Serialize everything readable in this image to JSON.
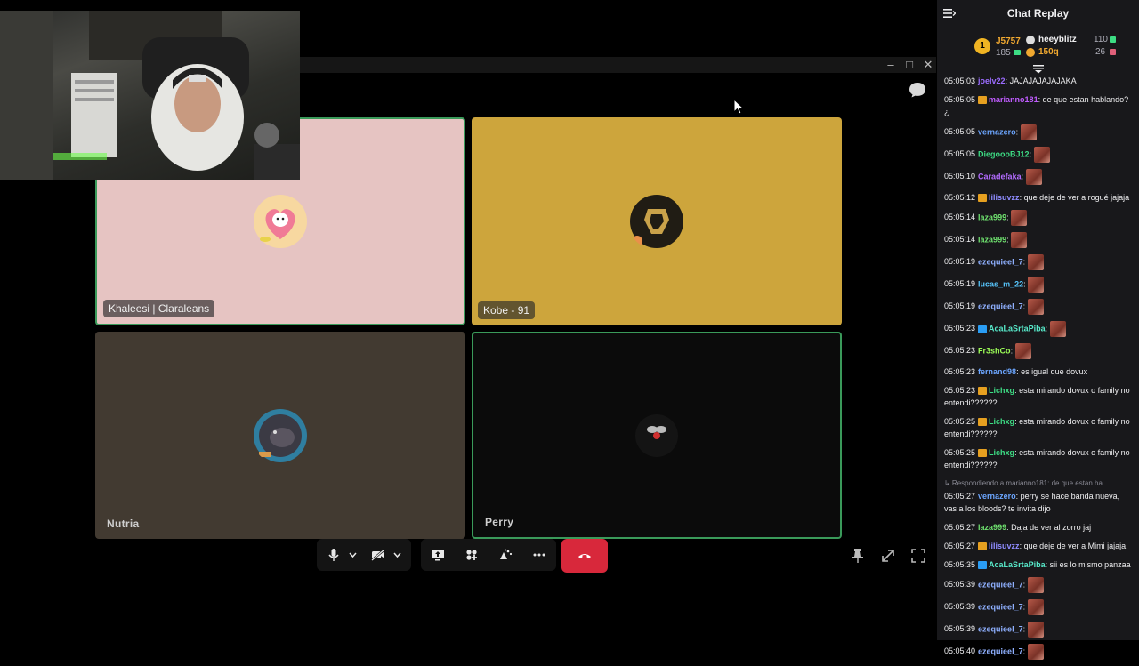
{
  "chat": {
    "title": "Chat Replay",
    "leaderboard": [
      {
        "rank": "1",
        "user": "J5757",
        "sub": "185",
        "color": "#f0a830"
      },
      {
        "user": "heeyblitz",
        "value": "110",
        "color": "#efeff1"
      },
      {
        "user": "150q",
        "value": "26",
        "color": "#f0a830"
      }
    ],
    "messages": [
      {
        "time": "05:05:03",
        "user": "joelv22",
        "color": "#9b6cff",
        "text": "JAJAJAJAJAJAKA"
      },
      {
        "time": "05:05:05",
        "user": "marianno181",
        "color": "#c05cff",
        "badge": "#e6a020",
        "text": "de que estan hablando?¿"
      },
      {
        "time": "05:05:05",
        "user": "vernazero",
        "color": "#6ca6ff",
        "text": "",
        "emote": true
      },
      {
        "time": "05:05:05",
        "user": "DiegoooBJ12",
        "color": "#3ddc84",
        "text": "",
        "emote": true
      },
      {
        "time": "05:05:10",
        "user": "Caradefaka",
        "color": "#b36cff",
        "text": "",
        "emote": true
      },
      {
        "time": "05:05:12",
        "user": "lilisuvzz",
        "color": "#8f8cff",
        "badge": "#e6a020",
        "text": "que deje de ver a rogué jajaja"
      },
      {
        "time": "05:05:14",
        "user": "laza999",
        "color": "#6fe36f",
        "text": "",
        "emote": true
      },
      {
        "time": "05:05:14",
        "user": "laza999",
        "color": "#6fe36f",
        "text": "",
        "emote": true
      },
      {
        "time": "05:05:19",
        "user": "ezequieel_7",
        "color": "#8fb0ff",
        "text": "",
        "emote": true
      },
      {
        "time": "05:05:19",
        "user": "lucas_m_22",
        "color": "#57c7ff",
        "text": "",
        "emote": true
      },
      {
        "time": "05:05:19",
        "user": "ezequieel_7",
        "color": "#8fb0ff",
        "text": "",
        "emote": true
      },
      {
        "time": "05:05:23",
        "user": "AcaLaSrtaPiba",
        "color": "#57e8c9",
        "badge": "#2a9df4",
        "text": "",
        "emote": true
      },
      {
        "time": "05:05:23",
        "user": "Fr3shCo",
        "color": "#9dff57",
        "text": "",
        "emote": true
      },
      {
        "time": "05:05:23",
        "user": "fernand98",
        "color": "#6ca6ff",
        "text": "es igual que dovux"
      },
      {
        "time": "05:05:23",
        "user": "Lichxg",
        "color": "#3ddc84",
        "badge": "#e6a020",
        "text": "esta mirando dovux o family no entendi??????"
      },
      {
        "time": "05:05:25",
        "user": "Lichxg",
        "color": "#3ddc84",
        "badge": "#e6a020",
        "text": "esta mirando dovux o family no entendi??????"
      },
      {
        "time": "05:05:25",
        "user": "Lichxg",
        "color": "#3ddc84",
        "badge": "#e6a020",
        "text": "esta mirando dovux o family no entendi??????"
      },
      {
        "reply": "Respondiendo a marianno181: de que estan ha...",
        "time": "05:05:27",
        "user": "vernazero",
        "color": "#6ca6ff",
        "text": "perry se hace banda nueva, vas a los bloods? te invita dijo"
      },
      {
        "time": "05:05:27",
        "user": "laza999",
        "color": "#6fe36f",
        "text": "Daja de ver al zorro jaj"
      },
      {
        "time": "05:05:27",
        "user": "lilisuvzz",
        "color": "#8f8cff",
        "badge": "#e6a020",
        "text": "que deje de ver a Mimi jajaja"
      },
      {
        "time": "05:05:35",
        "user": "AcaLaSrtaPiba",
        "color": "#57e8c9",
        "badge": "#2a9df4",
        "text": "sii es lo mismo panzaa"
      },
      {
        "time": "05:05:39",
        "user": "ezequieel_7",
        "color": "#8fb0ff",
        "text": "",
        "emote": true
      },
      {
        "time": "05:05:39",
        "user": "ezequieel_7",
        "color": "#8fb0ff",
        "text": "",
        "emote": true
      },
      {
        "time": "05:05:39",
        "user": "ezequieel_7",
        "color": "#8fb0ff",
        "text": "",
        "emote": true
      },
      {
        "time": "05:05:40",
        "user": "ezequieel_7",
        "color": "#8fb0ff",
        "text": "",
        "emote": true
      }
    ]
  },
  "call": {
    "participants": [
      {
        "name": "Khaleesi | Claraleans",
        "avatar_color": "#f3a3b6"
      },
      {
        "name": "Kobe - 91",
        "avatar_color": "#2a2418"
      },
      {
        "name": "Nutria",
        "avatar_color": "#3e7fa0"
      },
      {
        "name": "Perry",
        "avatar_color": "#1a1a1a"
      }
    ],
    "controls": [
      "microphone-icon",
      "camera-off-icon",
      "screen-share-icon",
      "apps-icon",
      "effects-icon",
      "more-icon",
      "hang-up-icon"
    ]
  }
}
